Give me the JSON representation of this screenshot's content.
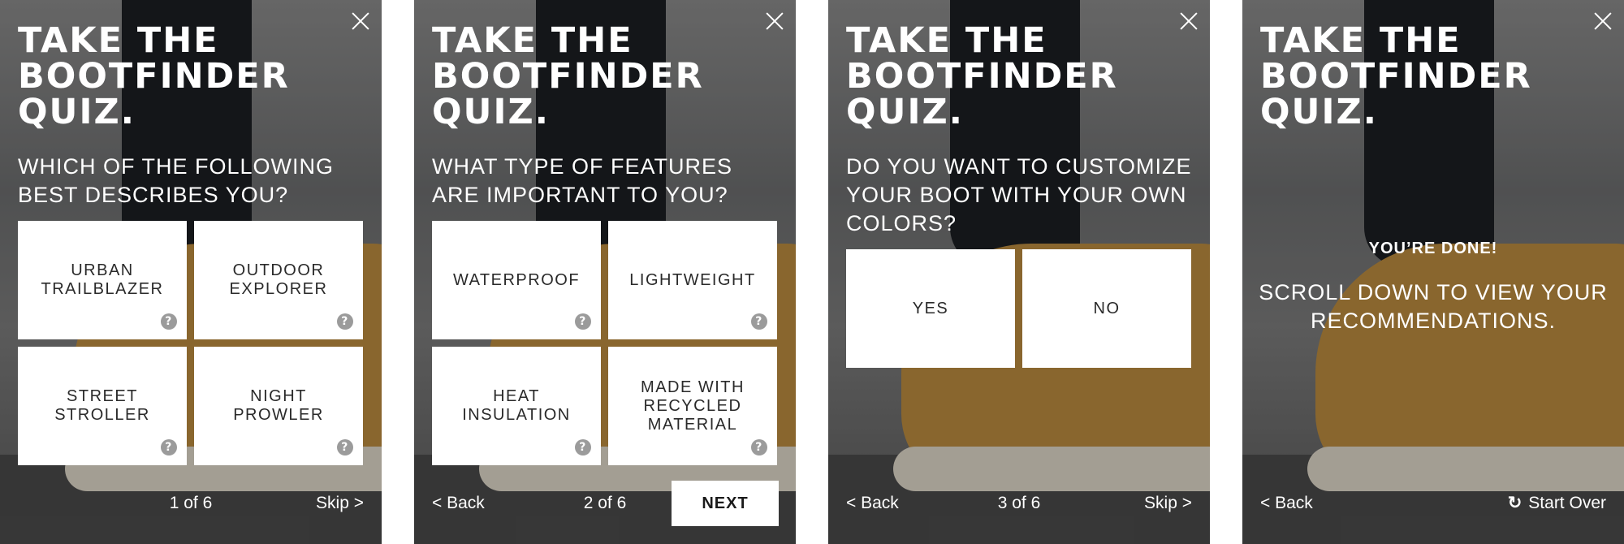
{
  "quiz_title": "TAKE THE BOOTFINDER QUIZ.",
  "panels": [
    {
      "question": "WHICH OF THE FOLLOWING BEST DESCRIBES YOU?",
      "options": [
        "URBAN TRAILBLAZER",
        "OUTDOOR EXPLORER",
        "STREET STROLLER",
        "NIGHT PROWLER"
      ],
      "progress": "1 of 6",
      "skip": "Skip >"
    },
    {
      "question": "WHAT TYPE OF FEATURES ARE IMPORTANT TO YOU?",
      "options": [
        "WATERPROOF",
        "LIGHTWEIGHT",
        "HEAT INSULATION",
        "MADE WITH RECYCLED MATERIAL"
      ],
      "back": "< Back",
      "progress": "2 of 6",
      "next": "NEXT"
    },
    {
      "question": "DO YOU WANT TO CUSTOMIZE YOUR BOOT WITH YOUR OWN COLORS?",
      "options": [
        "YES",
        "NO"
      ],
      "back": "< Back",
      "progress": "3 of 6",
      "skip": "Skip >"
    },
    {
      "done_heading": "YOU’RE DONE!",
      "done_message": "SCROLL DOWN TO VIEW YOUR RECOMMENDATIONS.",
      "back": "< Back",
      "start_over": "Start Over"
    }
  ],
  "icons": {
    "close": "close-icon",
    "help": "question-mark-icon",
    "restart": "refresh-icon"
  },
  "help_glyph": "?",
  "restart_glyph": "↻",
  "colors": {
    "card_bg": "#ffffff",
    "help_icon": "#9b9b9b",
    "text_light": "#ffffff",
    "text_dark": "#2a2a2a"
  }
}
